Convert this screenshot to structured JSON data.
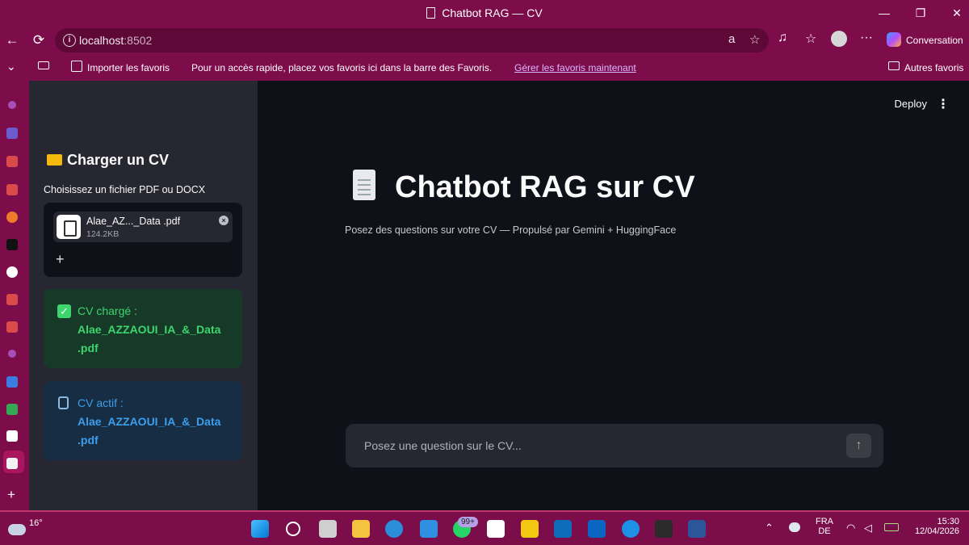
{
  "window": {
    "title": "Chatbot RAG — CV",
    "minimize": "—",
    "restore": "❐",
    "close": "✕"
  },
  "browser": {
    "back": "←",
    "reload": "⟳",
    "url_host": "localhost",
    "url_port": ":8502",
    "read_aloud_icon": "a",
    "star": "☆",
    "extensions": "♫",
    "favorites": "☆",
    "more": "···",
    "conversation": "Conversation"
  },
  "favbar": {
    "collapse": "⌄",
    "import": "Importer les favoris",
    "message": "Pour un accès rapide, placez vos favoris ici dans la barre des Favoris.",
    "manage_link": "Gérer les favoris maintenant",
    "other": "Autres favoris"
  },
  "sidebar": {
    "header": "Charger un CV",
    "uploader_label": "Choisissez un fichier PDF ou DOCX",
    "file_name": "Alae_AZ..._Data .pdf",
    "file_size": "124.2KB",
    "remove": "×",
    "add": "+",
    "success_line1": "CV chargé :",
    "success_line2": "Alae_AZZAOUI_IA_&_Data",
    "success_line3": ".pdf",
    "info_line1": "CV actif :",
    "info_line2": "Alae_AZZAOUI_IA_&_Data",
    "info_line3": ".pdf"
  },
  "main": {
    "deploy": "Deploy",
    "menu": "⋮",
    "title": "Chatbot RAG sur CV",
    "subtitle": "Posez des questions sur votre CV — Propulsé par Gemini + HuggingFace",
    "chat_placeholder": "Posez une question sur le CV...",
    "send": "↑"
  },
  "taskbar": {
    "temperature": "16°",
    "badge": "99+",
    "lang1": "FRA",
    "lang2": "DE",
    "time": "15:30",
    "date": "12/04/2026"
  },
  "colors": {
    "browser_frame": "#7d0c4b",
    "sidebar_bg": "#262730",
    "main_bg": "#0e1117",
    "success": "#3dd56d",
    "info": "#3c9eed"
  }
}
